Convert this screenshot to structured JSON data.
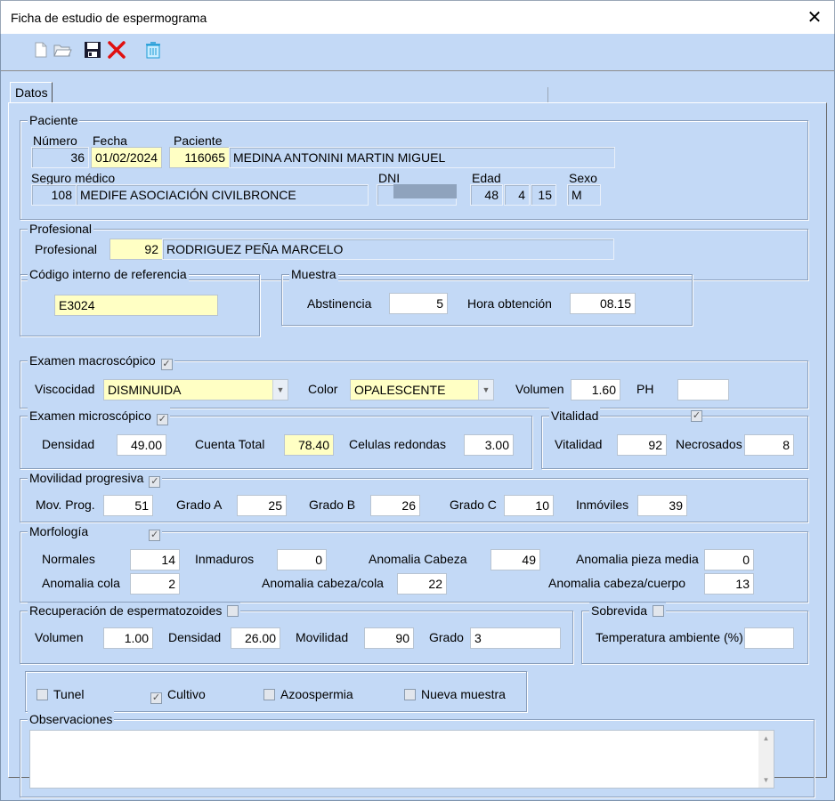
{
  "window": {
    "title": "Ficha de estudio de espermograma",
    "close_symbol": "✕"
  },
  "toolbar": {
    "icons": [
      "new-document-icon",
      "open-folder-icon",
      "save-icon",
      "delete-icon",
      "trash-icon"
    ]
  },
  "tabs": [
    {
      "label": "Datos"
    }
  ],
  "paciente": {
    "legend": "Paciente",
    "numero_label": "Número",
    "numero": "36",
    "fecha_label": "Fecha",
    "fecha": "01/02/2024",
    "paciente_label": "Paciente",
    "paciente_id": "116065",
    "nombre": "MEDINA ANTONINI MARTIN MIGUEL",
    "seguro_label": "Seguro médico",
    "seguro_id": "108",
    "seguro_nombre": "MEDIFE ASOCIACIÓN CIVILBRONCE",
    "dni_label": "DNI",
    "edad_label": "Edad",
    "edad_anios": "48",
    "edad_meses": "4",
    "edad_dias": "15",
    "sexo_label": "Sexo",
    "sexo": "M"
  },
  "profesional": {
    "legend": "Profesional",
    "label": "Profesional",
    "id": "92",
    "nombre": "RODRIGUEZ PEÑA MARCELO"
  },
  "codigo": {
    "legend": "Código interno de referencia",
    "value": "E3024"
  },
  "muestra": {
    "legend": "Muestra",
    "abstinencia_label": "Abstinencia",
    "abstinencia": "5",
    "hora_label": "Hora obtención",
    "hora": "08.15"
  },
  "macro": {
    "legend": "Examen macroscópico",
    "checked": "✓",
    "viscocidad_label": "Viscocidad",
    "viscocidad": "DISMINUIDA",
    "color_label": "Color",
    "color": "OPALESCENTE",
    "volumen_label": "Volumen",
    "volumen": "1.60",
    "ph_label": "PH",
    "ph": ""
  },
  "micro": {
    "legend": "Examen microscópico",
    "checked": "✓",
    "densidad_label": "Densidad",
    "densidad": "49.00",
    "cuenta_label": "Cuenta Total",
    "cuenta": "78.40",
    "celulas_label": "Celulas redondas",
    "celulas": "3.00"
  },
  "vitalidad": {
    "legend": "Vitalidad",
    "checked": "✓",
    "vitalidad_label": "Vitalidad",
    "vitalidad": "92",
    "necrosados_label": "Necrosados",
    "necrosados": "8"
  },
  "movilidad": {
    "legend": "Movilidad progresiva",
    "checked": "✓",
    "mov_label": "Mov. Prog.",
    "mov": "51",
    "a_label": "Grado A",
    "a": "25",
    "b_label": "Grado B",
    "b": "26",
    "c_label": "Grado C",
    "c": "10",
    "inm_label": "Inmóviles",
    "inm": "39"
  },
  "morfologia": {
    "legend": "Morfología",
    "checked": "✓",
    "normales_label": "Normales",
    "normales": "14",
    "inmaduros_label": "Inmaduros",
    "inmaduros": "0",
    "cabeza_label": "Anomalia Cabeza",
    "cabeza": "49",
    "pieza_label": "Anomalia pieza media",
    "pieza": "0",
    "cola_label": "Anomalia cola",
    "cola": "2",
    "cabcola_label": "Anomalia cabeza/cola",
    "cabcola": "22",
    "cabcuerpo_label": "Anomalia cabeza/cuerpo",
    "cabcuerpo": "13"
  },
  "recuperacion": {
    "legend": "Recuperación de espermatozoides",
    "volumen_label": "Volumen",
    "volumen": "1.00",
    "densidad_label": "Densidad",
    "densidad": "26.00",
    "movilidad_label": "Movilidad",
    "movilidad": "90",
    "grado_label": "Grado",
    "grado": "3"
  },
  "sobrevida": {
    "legend": "Sobrevida",
    "temp_label": "Temperatura ambiente (%)",
    "temp": ""
  },
  "opciones": {
    "tunel": "Tunel",
    "cultivo": "Cultivo",
    "cultivo_checked": "✓",
    "azoospermia": "Azoospermia",
    "nueva": "Nueva muestra"
  },
  "observaciones": {
    "legend": "Observaciones",
    "value": ""
  }
}
